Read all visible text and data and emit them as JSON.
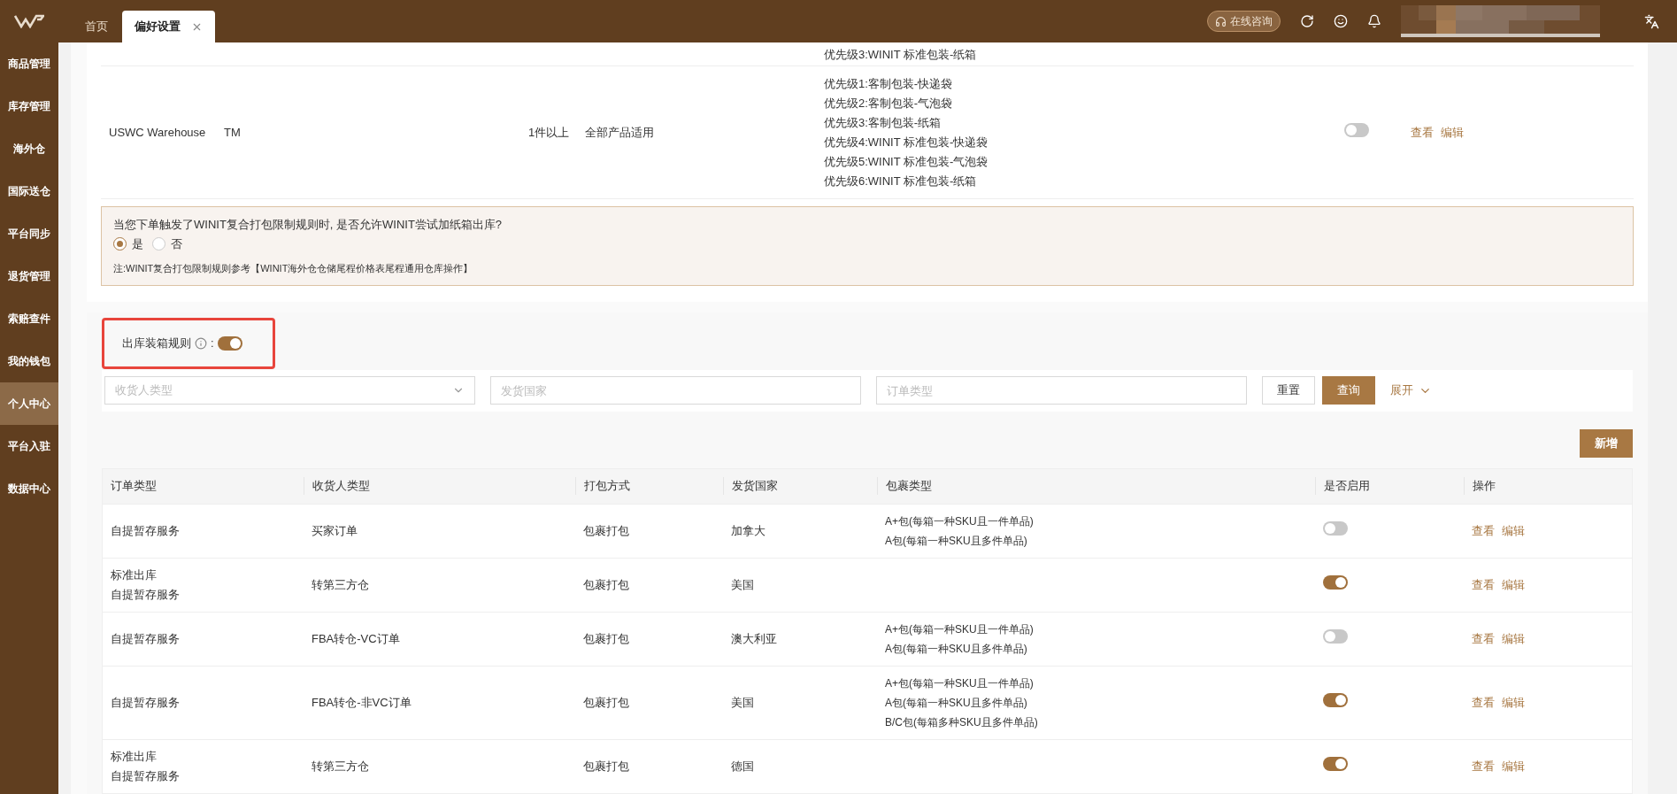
{
  "topbar": {
    "tabs": [
      {
        "label": "首页",
        "selected": false,
        "closable": false
      },
      {
        "label": "偏好设置",
        "selected": true,
        "closable": true
      }
    ],
    "consult_button": "在线咨询"
  },
  "sidebar": {
    "items": [
      {
        "label": "商品管理",
        "selected": false
      },
      {
        "label": "库存管理",
        "selected": false
      },
      {
        "label": "海外仓",
        "selected": false
      },
      {
        "label": "国际送仓",
        "selected": false
      },
      {
        "label": "平台同步",
        "selected": false
      },
      {
        "label": "退货管理",
        "selected": false
      },
      {
        "label": "索赔查件",
        "selected": false
      },
      {
        "label": "我的钱包",
        "selected": false
      },
      {
        "label": "个人中心",
        "selected": true
      },
      {
        "label": "平台入驻",
        "selected": false
      },
      {
        "label": "数据中心",
        "selected": false
      }
    ]
  },
  "upper_table": {
    "partial_row": {
      "priorities": [
        "优先级3:WINIT 标准包装-纸箱"
      ]
    },
    "rows": [
      {
        "column_1": "USWC Warehouse",
        "column_2": "TM",
        "column_3": "1件以上",
        "column_4": "全部产品适用",
        "priorities": [
          "优先级1:客制包装-快递袋",
          "优先级2:客制包装-气泡袋",
          "优先级3:客制包装-纸箱",
          "优先级4:WINIT 标准包装-快递袋",
          "优先级5:WINIT 标准包装-气泡袋",
          "优先级6:WINIT 标准包装-纸箱"
        ],
        "enabled": false,
        "actions": [
          "查看",
          "编辑"
        ]
      }
    ]
  },
  "notice": {
    "question": "当您下单触发了WINIT复合打包限制规则时, 是否允许WINIT尝试加纸箱出库?",
    "options": [
      {
        "label": "是",
        "selected": true
      },
      {
        "label": "否",
        "selected": false
      }
    ],
    "note": "注:WINIT复合打包限制规则参考【WINIT海外仓仓储尾程价格表尾程通用仓库操作】"
  },
  "rules": {
    "title": "出库装箱规则",
    "colon": ":",
    "enabled": true,
    "filters": [
      {
        "kind": "select",
        "placeholder": "收货人类型"
      },
      {
        "kind": "input",
        "placeholder": "发货国家"
      },
      {
        "kind": "input",
        "placeholder": "订单类型"
      }
    ],
    "reset": "重置",
    "query": "查询",
    "expand": "展开",
    "add": "新增",
    "columns": [
      "订单类型",
      "收货人类型",
      "打包方式",
      "发货国家",
      "包裹类型",
      "是否启用",
      "操作"
    ],
    "rows": [
      {
        "order_types": [
          "自提暂存服务"
        ],
        "consignee": "买家订单",
        "packing": "包裹打包",
        "country": "加拿大",
        "package_types": [
          "A+包(每箱一种SKU且一件单品)",
          "A包(每箱一种SKU且多件单品)"
        ],
        "enabled": false,
        "actions": [
          "查看",
          "编辑"
        ]
      },
      {
        "order_types": [
          "标准出库",
          "自提暂存服务"
        ],
        "consignee": "转第三方仓",
        "packing": "包裹打包",
        "country": "美国",
        "package_types": [],
        "enabled": true,
        "actions": [
          "查看",
          "编辑"
        ]
      },
      {
        "order_types": [
          "自提暂存服务"
        ],
        "consignee": "FBA转仓-VC订单",
        "packing": "包裹打包",
        "country": "澳大利亚",
        "package_types": [
          "A+包(每箱一种SKU且一件单品)",
          "A包(每箱一种SKU且多件单品)"
        ],
        "enabled": false,
        "actions": [
          "查看",
          "编辑"
        ]
      },
      {
        "order_types": [
          "自提暂存服务"
        ],
        "consignee": "FBA转仓-非VC订单",
        "packing": "包裹打包",
        "country": "美国",
        "package_types": [
          "A+包(每箱一种SKU且一件单品)",
          "A包(每箱一种SKU且多件单品)",
          "B/C包(每箱多种SKU且多件单品)"
        ],
        "enabled": true,
        "actions": [
          "查看",
          "编辑"
        ]
      },
      {
        "order_types": [
          "标准出库",
          "自提暂存服务"
        ],
        "consignee": "转第三方仓",
        "packing": "包裹打包",
        "country": "德国",
        "package_types": [],
        "enabled": true,
        "actions": [
          "查看",
          "编辑"
        ]
      }
    ]
  }
}
